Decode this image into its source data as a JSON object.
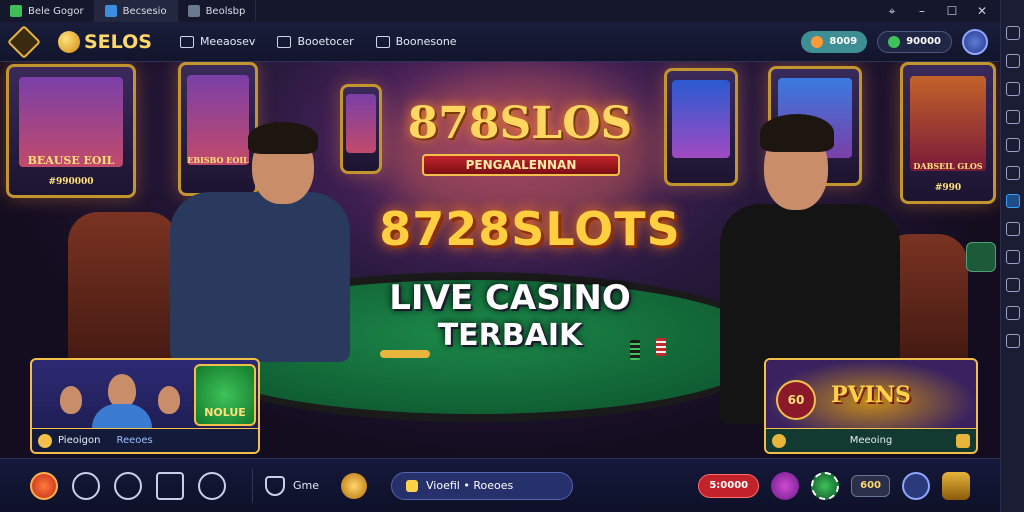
{
  "tabs": [
    {
      "label": "Bele Gogor",
      "icon": "game-icon"
    },
    {
      "label": "Becsesio",
      "icon": "window-icon"
    },
    {
      "label": "Beolsbp",
      "icon": "image-icon"
    }
  ],
  "header": {
    "brand": "SELOS",
    "nav": [
      {
        "label": "Meeaosev",
        "icon": "monitor-icon"
      },
      {
        "label": "Booetocer",
        "icon": "calendar-icon"
      },
      {
        "label": "Boonesone",
        "icon": "gift-icon"
      }
    ],
    "balance_pill": "8009",
    "coins_pill": "90000"
  },
  "hero": {
    "logo_title": "878SLOS",
    "logo_subtitle": "PENGAALENNAN",
    "headline": "8728SLOTS",
    "line1": "LIVE CASINO",
    "line2": "TERBAIK",
    "machine_left_text": "BEAUSE EOIL",
    "machine_left_amount": "#990000",
    "machine_left2_text": "EBISBO EOIL",
    "machine_right_text": "DABSEIL GLOS",
    "machine_right_amount": "#990",
    "promo_left": {
      "green_label": "NOLUE",
      "bar_left": "Pieoigon",
      "bar_right": "Reeoes"
    },
    "promo_right": {
      "title": "PVINS",
      "badge": "60",
      "bar_label": "Meeoing"
    }
  },
  "toolbar": {
    "game_label": "Gme",
    "search_text": "Vioefil • Roeoes",
    "red_pill": "5:0000",
    "small_pill": "600"
  },
  "colors": {
    "accent_gold": "#ffd660",
    "bg": "#0d0f24",
    "felt": "#1c8a4a"
  }
}
